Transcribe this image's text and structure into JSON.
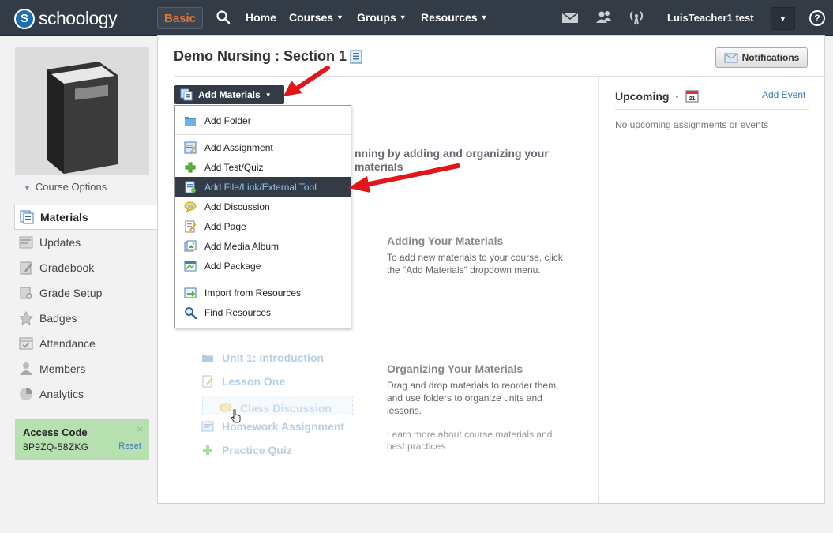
{
  "topbar": {
    "logo_letter": "S",
    "logo_text": "schoology",
    "plan_badge": "Basic",
    "nav": [
      {
        "label": "Home"
      },
      {
        "label": "Courses"
      },
      {
        "label": "Groups"
      },
      {
        "label": "Resources"
      }
    ],
    "user_name": "LuisTeacher1 test",
    "help_label": "?"
  },
  "sidebar": {
    "course_options": "Course Options",
    "items": [
      {
        "label": "Materials",
        "icon": "materials-icon",
        "active": true
      },
      {
        "label": "Updates",
        "icon": "updates-icon"
      },
      {
        "label": "Gradebook",
        "icon": "gradebook-icon"
      },
      {
        "label": "Grade Setup",
        "icon": "grade-setup-icon"
      },
      {
        "label": "Badges",
        "icon": "badge-icon"
      },
      {
        "label": "Attendance",
        "icon": "attendance-icon"
      },
      {
        "label": "Members",
        "icon": "members-icon"
      },
      {
        "label": "Analytics",
        "icon": "analytics-icon"
      }
    ],
    "access_code": {
      "label": "Access Code",
      "code": "8P9ZQ-58ZKG",
      "reset": "Reset",
      "close": "×"
    }
  },
  "main": {
    "title": "Demo Nursing : Section 1",
    "notifications_btn": "Notifications",
    "add_materials": "Add Materials",
    "dropdown": [
      {
        "label": "Add Folder",
        "icon": "folder-icon"
      },
      {
        "label": "Add Assignment",
        "icon": "assignment-icon"
      },
      {
        "label": "Add Test/Quiz",
        "icon": "quiz-icon"
      },
      {
        "label": "Add File/Link/External Tool",
        "icon": "file-link-icon",
        "highlighted": true
      },
      {
        "label": "Add Discussion",
        "icon": "discussion-icon"
      },
      {
        "label": "Add Page",
        "icon": "page-icon"
      },
      {
        "label": "Add Media Album",
        "icon": "media-album-icon"
      },
      {
        "label": "Add Package",
        "icon": "package-icon"
      },
      {
        "label": "Import from Resources",
        "icon": "import-icon"
      },
      {
        "label": "Find Resources",
        "icon": "magnifier-icon"
      }
    ],
    "intro_line1": "nning by adding and organizing your",
    "intro_line2": "materials",
    "adding_title": "Adding Your Materials",
    "adding_text": "To add new materials to your course, click the \"Add Materials\" dropdown menu.",
    "organizing_title": "Organizing Your Materials",
    "organizing_text": "Drag and drop materials to reorder them, and use folders to organize units and lessons.",
    "learn_more": "Learn more about course materials and best practices",
    "sample_items": [
      {
        "label": "Unit 1: Introduction"
      },
      {
        "label": "Lesson One"
      },
      {
        "label": "Class Discussion"
      },
      {
        "label": "Homework Assignment"
      },
      {
        "label": "Practice Quiz"
      }
    ]
  },
  "upcoming": {
    "title": "Upcoming",
    "calendar_day": "21",
    "add_event": "Add Event",
    "empty": "No upcoming assignments or events"
  },
  "colors": {
    "topbar": "#333c46",
    "accent_orange": "#e6743a",
    "link": "#3d78b5",
    "access_bg": "#b7e0b1",
    "arrow_red": "#e0161b"
  }
}
